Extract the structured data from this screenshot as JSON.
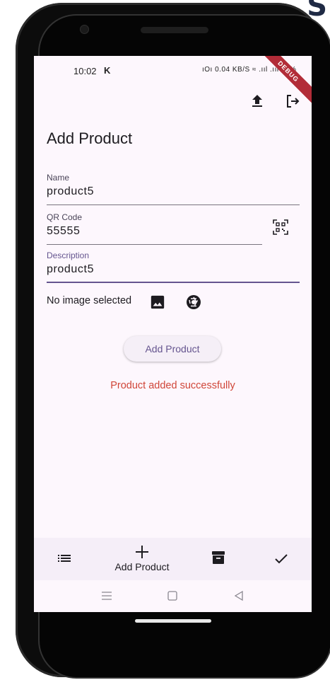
{
  "status_bar": {
    "time": "10:02",
    "app_icon": "K",
    "indicators": "ıOı 0.04 KB/S ≈ .ııl .ııl 72%",
    "debug_banner": "DEBUG"
  },
  "app_bar": {
    "upload_icon": "upload-icon",
    "logout_icon": "logout-icon"
  },
  "page": {
    "title": "Add Product"
  },
  "form": {
    "name": {
      "label": "Name",
      "value": "product5"
    },
    "qr_code": {
      "label": "QR Code",
      "value": "55555"
    },
    "description": {
      "label": "Description",
      "value": "product5"
    },
    "image_status": "No image selected",
    "submit_label": "Add Product",
    "success_message": "Product added successfully"
  },
  "bottom_nav": {
    "items": [
      {
        "icon": "list-icon",
        "label": ""
      },
      {
        "icon": "plus-icon",
        "label": "Add Product"
      },
      {
        "icon": "archive-icon",
        "label": ""
      },
      {
        "icon": "check-icon",
        "label": ""
      }
    ]
  },
  "colors": {
    "background": "#fdf7fd",
    "accent": "#65558f",
    "error": "#d04638",
    "debug_banner": "#b22c38"
  }
}
